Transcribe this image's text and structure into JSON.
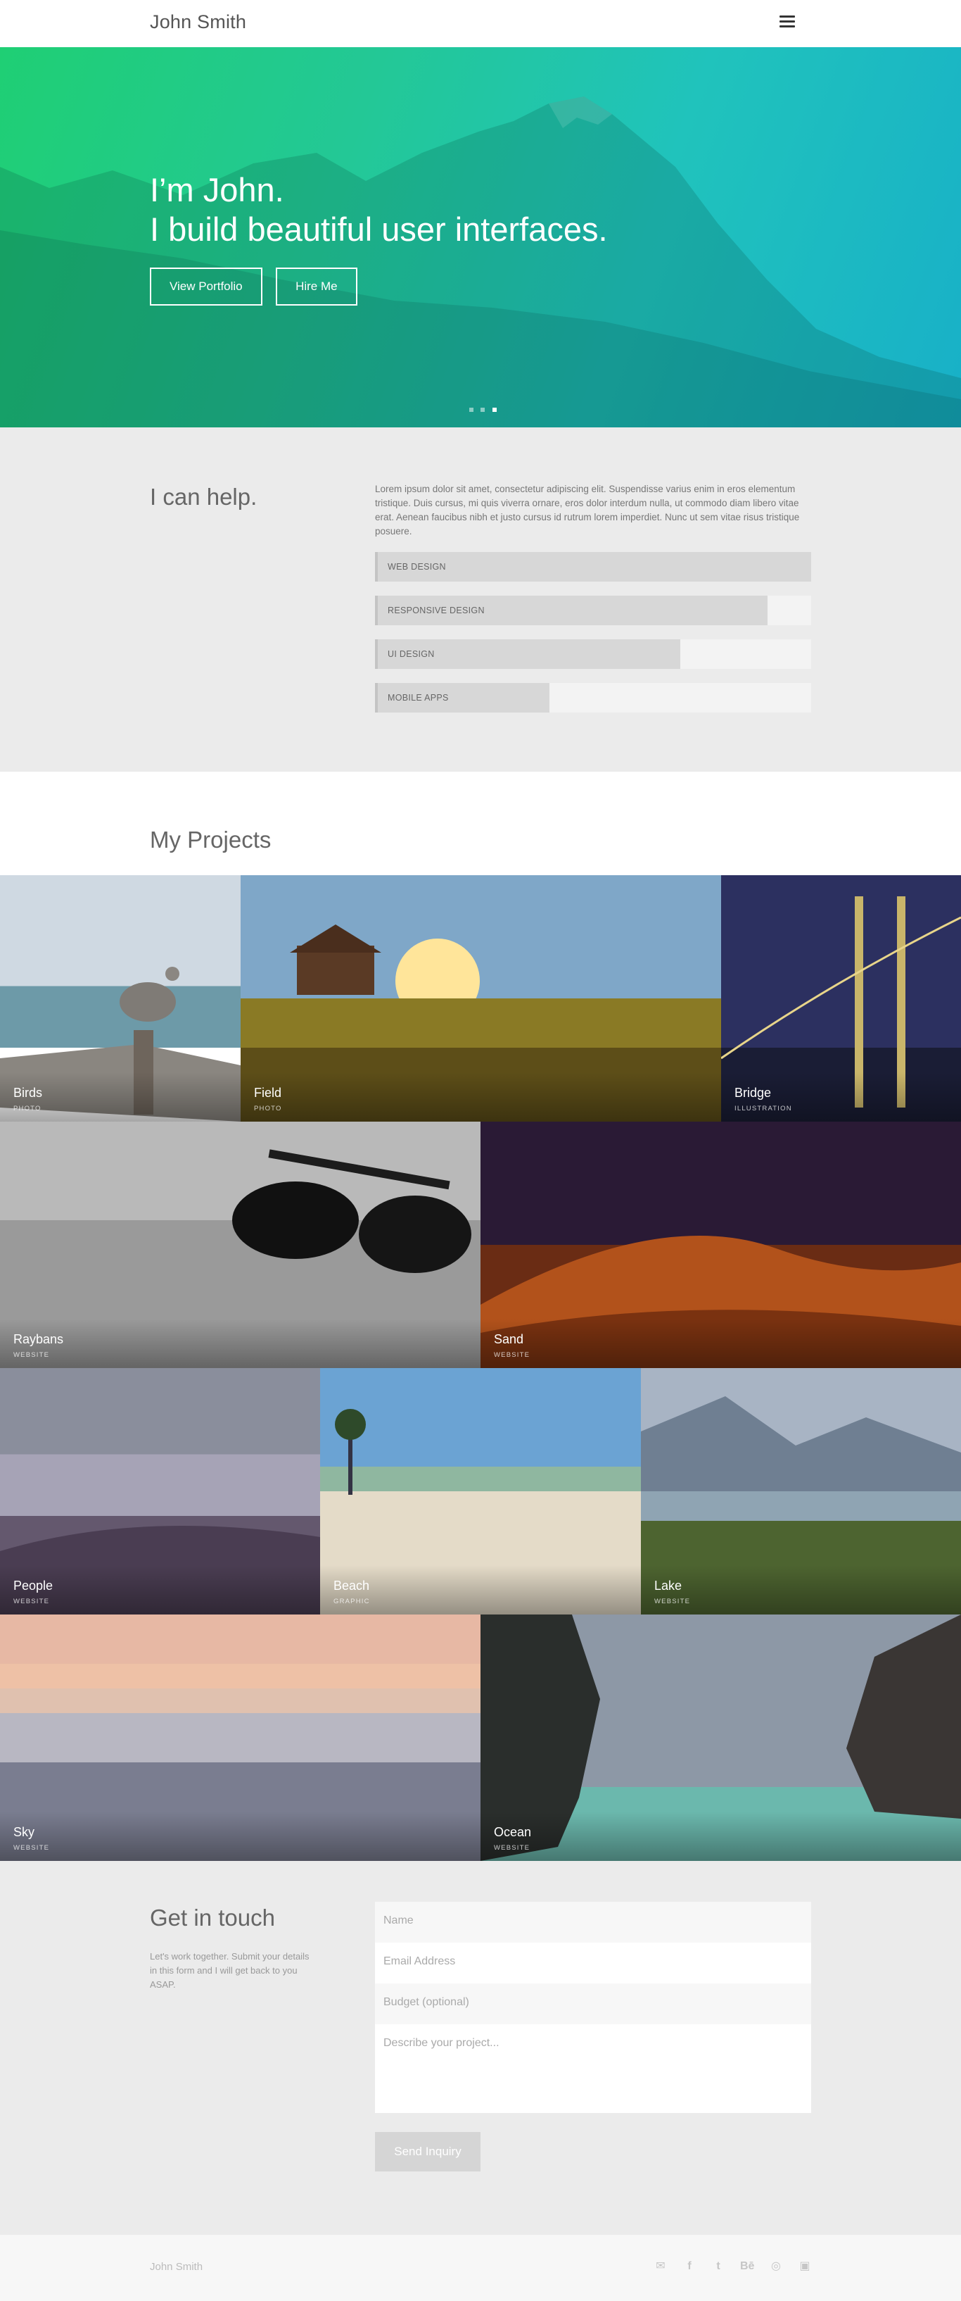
{
  "header": {
    "brand": "John Smith",
    "menu_icon": "hamburger-menu-icon"
  },
  "hero": {
    "line1": "I’m John.",
    "line2": "I build beautiful user interfaces.",
    "buttons": [
      "View Portfolio",
      "Hire Me"
    ],
    "slides": 3,
    "active_slide": 3,
    "gradient": [
      "#1fcf74",
      "#18b0c8"
    ]
  },
  "help": {
    "title": "I can help.",
    "copy": "Lorem ipsum dolor sit amet, consectetur adipiscing elit. Suspendisse varius enim in eros elementum tristique. Duis cursus, mi quis viverra ornare, eros dolor interdum nulla, ut commodo diam libero vitae erat. Aenean faucibus nibh et justo cursus id rutrum lorem imperdiet. Nunc ut sem vitae risus tristique posuere.",
    "skills": [
      {
        "label": "WEB DESIGN",
        "level": 1.0
      },
      {
        "label": "RESPONSIVE DESIGN",
        "level": 0.9
      },
      {
        "label": "UI DESIGN",
        "level": 0.7
      },
      {
        "label": "MOBILE APPS",
        "level": 0.4
      }
    ]
  },
  "projects": {
    "title": "My Projects",
    "items": [
      {
        "name": "Birds",
        "category": "PHOTO",
        "scene": "pier-pelican"
      },
      {
        "name": "Field",
        "category": "PHOTO",
        "scene": "sunset-field"
      },
      {
        "name": "Bridge",
        "category": "ILLUSTRATION",
        "scene": "night-bridge"
      },
      {
        "name": "Raybans",
        "category": "WEBSITE",
        "scene": "sunglasses"
      },
      {
        "name": "Sand",
        "category": "WEBSITE",
        "scene": "desert-dunes"
      },
      {
        "name": "People",
        "category": "WEBSITE",
        "scene": "foggy-shore"
      },
      {
        "name": "Beach",
        "category": "GRAPHIC",
        "scene": "sunny-beach"
      },
      {
        "name": "Lake",
        "category": "WEBSITE",
        "scene": "mountain-lake"
      },
      {
        "name": "Sky",
        "category": "WEBSITE",
        "scene": "pastel-sky"
      },
      {
        "name": "Ocean",
        "category": "WEBSITE",
        "scene": "cliff-ocean"
      }
    ]
  },
  "contact": {
    "title": "Get in touch",
    "copy": "Let's work together. Submit your details in this form and I will get back to you ASAP.",
    "name_placeholder": "Name",
    "email_placeholder": "Email Address",
    "budget_placeholder": "Budget (optional)",
    "project_placeholder": "Describe your project...",
    "submit": "Send Inquiry"
  },
  "footer": {
    "brand": "John Smith",
    "socials": [
      "mail-icon",
      "facebook-icon",
      "twitter-icon",
      "behance-icon",
      "dribbble-icon",
      "instagram-icon"
    ],
    "social_glyphs": [
      "✉",
      "f",
      "t",
      "Bē",
      "◎",
      "▣"
    ]
  }
}
